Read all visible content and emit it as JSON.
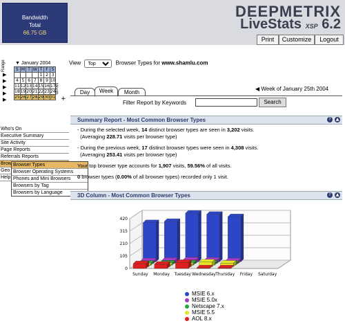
{
  "bandwidth": {
    "line1": "Bandwidth",
    "line2": "Total",
    "value": "66.75 GB"
  },
  "logo": {
    "brand": "DEEPMETRIX",
    "product": "LiveStats",
    "edition": "XSP",
    "version": "6.2"
  },
  "topbuttons": {
    "print": "Print",
    "customize": "Customize",
    "logout": "Logout"
  },
  "calendar": {
    "month": "January 2004",
    "range_label": "Range",
    "month_label": "Month",
    "days": [
      "S",
      "M",
      "T",
      "W",
      "T",
      "F",
      "S"
    ],
    "weeks": [
      [
        "",
        "",
        "",
        "",
        "1",
        "2",
        "3"
      ],
      [
        "4",
        "5",
        "6",
        "7",
        "8",
        "9",
        "10"
      ],
      [
        "11",
        "12",
        "13",
        "14",
        "15",
        "16",
        "17"
      ],
      [
        "18",
        "19",
        "20",
        "21",
        "22",
        "23",
        "24"
      ],
      [
        "25",
        "26",
        "27",
        "28",
        "29",
        "30",
        "31"
      ]
    ]
  },
  "nav": {
    "items": [
      "Who's On",
      "Executive Summary",
      "Site Activity",
      "Page Reports",
      "Referrals Reports",
      "Browsers",
      "Geo",
      "Help"
    ],
    "submenu": [
      "Browser Types",
      "Browser Operating Systems",
      "Phones and Mini Browsers",
      "Browsers by Tag",
      "Browsers by Language"
    ]
  },
  "view": {
    "label": "View",
    "select": "Top",
    "text": "Browser Types for",
    "site": "www.shamlu.com"
  },
  "tabs": [
    "Day",
    "Week",
    "Month"
  ],
  "week_of": "Week of January 25th 2004",
  "filter": {
    "label": "Filter Report by Keywords",
    "value": "",
    "button": "Search"
  },
  "summary": {
    "title": "Summary Report - Most Common Browser Types",
    "p1a": "During the selected week,",
    "p1b": "14",
    "p1c": "distinct browser types are seen in",
    "p1d": "3,202",
    "p1e": "visits.",
    "p1f": "(Averaging",
    "p1g": "228.71",
    "p1h": "visits per browser type)",
    "p2a": "During the previous week,",
    "p2b": "17",
    "p2c": "distinct browser types were seen in",
    "p2d": "4,308",
    "p2e": "visits.",
    "p2f": "(Averaging",
    "p2g": "253.41",
    "p2h": "visits per browser type)",
    "p3a": "Your top browser type accounts for",
    "p3b": "1,907",
    "p3c": "visits,",
    "p3d": "59.56%",
    "p3e": "of all visits.",
    "p4a": "0",
    "p4b": "browser types (",
    "p4c": "0.00%",
    "p4d": "of all browser types) recorded only 1 visit."
  },
  "chart_section_title": "3D Column - Most Common Browser Types",
  "chart_data": {
    "type": "bar",
    "title": "",
    "categories": [
      "Sunday",
      "Monday",
      "Tuesday",
      "Wednesday",
      "Thursday",
      "Friday",
      "Saturday"
    ],
    "yticks": [
      0,
      105,
      210,
      315,
      420
    ],
    "ylim": [
      0,
      420
    ],
    "series": [
      {
        "name": "MSIE 6.x",
        "color": "#2d46c8",
        "values": [
          330,
          340,
          410,
          400,
          380,
          0,
          0
        ]
      },
      {
        "name": "MSIE 5.0x",
        "color": "#a53bc8",
        "values": [
          22,
          26,
          30,
          28,
          22,
          0,
          0
        ]
      },
      {
        "name": "Netscape 7.x",
        "color": "#2aa83a",
        "values": [
          14,
          16,
          18,
          16,
          14,
          0,
          0
        ]
      },
      {
        "name": "MSIE 5.5",
        "color": "#e6e628",
        "values": [
          8,
          10,
          12,
          40,
          30,
          0,
          0
        ]
      },
      {
        "name": "AOL 8.x",
        "color": "#e02020",
        "values": [
          40,
          35,
          50,
          5,
          5,
          0,
          0
        ]
      }
    ]
  }
}
